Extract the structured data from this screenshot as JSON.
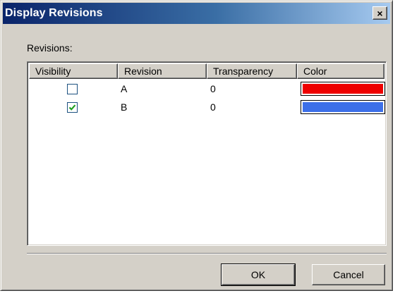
{
  "window": {
    "title": "Display Revisions",
    "close_glyph": "×"
  },
  "revisions_label": "Revisions:",
  "table": {
    "columns": [
      "Visibility",
      "Revision",
      "Transparency",
      "Color"
    ],
    "rows": [
      {
        "visible": false,
        "revision": "A",
        "transparency": "0",
        "color": "#ee0000"
      },
      {
        "visible": true,
        "revision": "B",
        "transparency": "0",
        "color": "#3c6fe8"
      }
    ]
  },
  "buttons": {
    "ok_label": "OK",
    "cancel_label": "Cancel"
  },
  "colors": {
    "checkmark": "#21a121",
    "checkbox_border": "#1c5180"
  }
}
